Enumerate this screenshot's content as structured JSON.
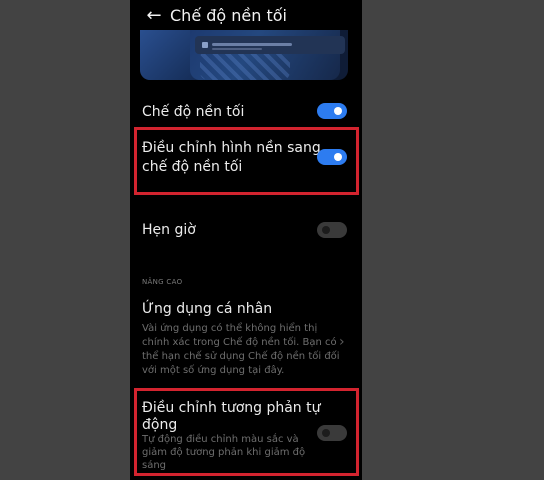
{
  "header": {
    "back_icon": "arrow-left-icon",
    "title": "Chế độ nền tối"
  },
  "settings": {
    "dark_mode": {
      "label": "Chế độ nền tối",
      "enabled": true
    },
    "adjust_wallpaper": {
      "label_line1": "Điều chỉnh hình nền sang",
      "label_line2": "chế độ nền tối",
      "enabled": true
    },
    "schedule": {
      "label": "Hẹn giờ",
      "enabled": false
    }
  },
  "advanced": {
    "header": "NÂNG CAO",
    "personal_apps": {
      "title": "Ứng dụng cá nhân",
      "desc_lines": [
        "Vài ứng dụng có thể không hiển thị",
        "chính xác trong Chế độ nền tối. Bạn có",
        "thể hạn chế sử dụng Chế độ nền tối đối",
        "với một số ứng dụng tại đây."
      ]
    },
    "auto_contrast": {
      "title_line1": "Điều chỉnh tương phản tự",
      "title_line2": "động",
      "desc_lines": [
        "Tự động điều chỉnh màu sắc và",
        "giảm độ tương phản khi giảm độ",
        "sáng"
      ],
      "enabled": false
    }
  },
  "colors": {
    "toggle_on": "#2d7cf0",
    "highlight": "#d3242f",
    "background": "#000000",
    "outer_background": "#434343"
  }
}
